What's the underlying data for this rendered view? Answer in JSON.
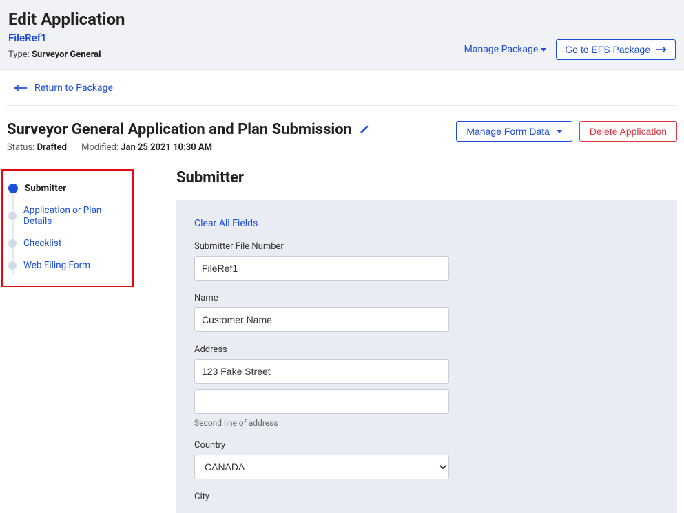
{
  "header": {
    "title": "Edit Application",
    "file_ref": "FileRef1",
    "type_label": "Type:",
    "type_value": "Surveyor General",
    "manage_package": "Manage Package",
    "go_to_efs": "Go to EFS Package"
  },
  "return_link": "Return to Package",
  "form_header": {
    "title": "Surveyor General Application and Plan Submission",
    "status_label": "Status:",
    "status_value": "Drafted",
    "modified_label": "Modified:",
    "modified_value": "Jan 25 2021 10:30 AM",
    "manage_form_data": "Manage Form Data",
    "delete_application": "Delete Application"
  },
  "stepper": {
    "items": [
      {
        "label": "Submitter"
      },
      {
        "label": "Application or Plan Details"
      },
      {
        "label": "Checklist"
      },
      {
        "label": "Web Filing Form"
      }
    ]
  },
  "section": {
    "title": "Submitter",
    "clear_all": "Clear All Fields",
    "fields": {
      "file_no_label": "Submitter File Number",
      "file_no_value": "FileRef1",
      "name_label": "Name",
      "name_value": "Customer Name",
      "address_label": "Address",
      "address1_value": "123 Fake Street",
      "address2_value": "",
      "address_help": "Second line of address",
      "country_label": "Country",
      "country_value": "CANADA",
      "city_label": "City"
    }
  }
}
